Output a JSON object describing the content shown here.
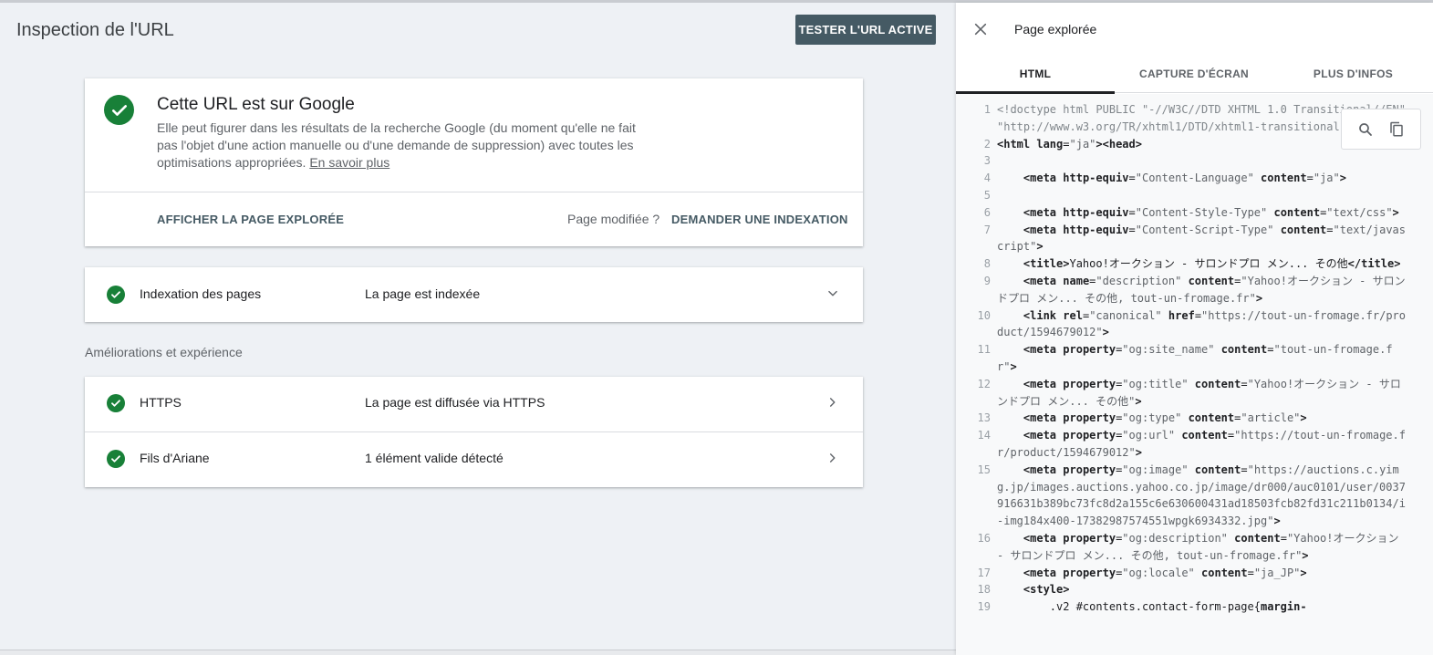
{
  "header": {
    "title": "Inspection de l'URL",
    "test_button": "TESTER L'URL ACTIVE"
  },
  "status_card": {
    "title": "Cette URL est sur Google",
    "description": "Elle peut figurer dans les résultats de la recherche Google (du moment qu'elle ne fait pas l'objet d'une action manuelle ou d'une demande de suppression) avec toutes les optimisations appropriées.",
    "learn_more": "En savoir plus",
    "view_page_button": "AFFICHER LA PAGE EXPLORÉE",
    "page_modified": "Page modifiée ?",
    "request_indexing_button": "DEMANDER UNE INDEXATION"
  },
  "indexing": {
    "label": "Indexation des pages",
    "status": "La page est indexée"
  },
  "enhancements": {
    "section_title": "Améliorations et expérience",
    "rows": [
      {
        "label": "HTTPS",
        "status": "La page est diffusée via HTTPS"
      },
      {
        "label": "Fils d'Ariane",
        "status": "1 élément valide détecté"
      }
    ]
  },
  "panel": {
    "title": "Page explorée",
    "tabs": [
      "HTML",
      "CAPTURE D'ÉCRAN",
      "PLUS D'INFOS"
    ],
    "active_tab": "HTML",
    "code_lines": [
      {
        "n": "1",
        "parts": [
          [
            "c",
            "<!doctype html PUBLIC \"-//W3C//DTD XHTML 1.0 Transitional//EN\" \"http://www.w3.org/TR/xhtml1/DTD/xhtml1-transitional.dtd\">"
          ]
        ]
      },
      {
        "n": "2",
        "parts": [
          [
            "t",
            "<html "
          ],
          [
            "a",
            "lang"
          ],
          [
            "p",
            "="
          ],
          [
            "v",
            "\"ja\""
          ],
          [
            "t",
            "><head>"
          ]
        ]
      },
      {
        "n": "3",
        "parts": []
      },
      {
        "n": "4",
        "parts": [
          [
            "p",
            "    "
          ],
          [
            "t",
            "<meta "
          ],
          [
            "a",
            "http-equiv"
          ],
          [
            "p",
            "="
          ],
          [
            "v",
            "\"Content-Language\""
          ],
          [
            "p",
            " "
          ],
          [
            "a",
            "content"
          ],
          [
            "p",
            "="
          ],
          [
            "v",
            "\"ja\""
          ],
          [
            "t",
            ">"
          ]
        ]
      },
      {
        "n": "5",
        "parts": []
      },
      {
        "n": "6",
        "parts": [
          [
            "p",
            "    "
          ],
          [
            "t",
            "<meta "
          ],
          [
            "a",
            "http-equiv"
          ],
          [
            "p",
            "="
          ],
          [
            "v",
            "\"Content-Style-Type\""
          ],
          [
            "p",
            " "
          ],
          [
            "a",
            "content"
          ],
          [
            "p",
            "="
          ],
          [
            "v",
            "\"text/css\""
          ],
          [
            "t",
            ">"
          ]
        ]
      },
      {
        "n": "7",
        "parts": [
          [
            "p",
            "    "
          ],
          [
            "t",
            "<meta "
          ],
          [
            "a",
            "http-equiv"
          ],
          [
            "p",
            "="
          ],
          [
            "v",
            "\"Content-Script-Type\""
          ],
          [
            "p",
            " "
          ],
          [
            "a",
            "content"
          ],
          [
            "p",
            "="
          ],
          [
            "v",
            "\"text/javascript\""
          ],
          [
            "t",
            ">"
          ]
        ]
      },
      {
        "n": "8",
        "parts": [
          [
            "p",
            "    "
          ],
          [
            "t",
            "<title>"
          ],
          [
            "p",
            "Yahoo!オークション - サロンドプロ メン... その他"
          ],
          [
            "t",
            "</title>"
          ]
        ]
      },
      {
        "n": "9",
        "parts": [
          [
            "p",
            "    "
          ],
          [
            "t",
            "<meta "
          ],
          [
            "a",
            "name"
          ],
          [
            "p",
            "="
          ],
          [
            "v",
            "\"description\""
          ],
          [
            "p",
            " "
          ],
          [
            "a",
            "content"
          ],
          [
            "p",
            "="
          ],
          [
            "v",
            "\"Yahoo!オークション - サロンドプロ メン... その他, tout-un-fromage.fr\""
          ],
          [
            "t",
            ">"
          ]
        ]
      },
      {
        "n": "10",
        "parts": [
          [
            "p",
            "    "
          ],
          [
            "t",
            "<link "
          ],
          [
            "a",
            "rel"
          ],
          [
            "p",
            "="
          ],
          [
            "v",
            "\"canonical\""
          ],
          [
            "p",
            " "
          ],
          [
            "a",
            "href"
          ],
          [
            "p",
            "="
          ],
          [
            "v",
            "\"https://tout-un-fromage.fr/product/1594679012\""
          ],
          [
            "t",
            ">"
          ]
        ]
      },
      {
        "n": "11",
        "parts": [
          [
            "p",
            "    "
          ],
          [
            "t",
            "<meta "
          ],
          [
            "a",
            "property"
          ],
          [
            "p",
            "="
          ],
          [
            "v",
            "\"og:site_name\""
          ],
          [
            "p",
            " "
          ],
          [
            "a",
            "content"
          ],
          [
            "p",
            "="
          ],
          [
            "v",
            "\"tout-un-fromage.fr\""
          ],
          [
            "t",
            ">"
          ]
        ]
      },
      {
        "n": "12",
        "parts": [
          [
            "p",
            "    "
          ],
          [
            "t",
            "<meta "
          ],
          [
            "a",
            "property"
          ],
          [
            "p",
            "="
          ],
          [
            "v",
            "\"og:title\""
          ],
          [
            "p",
            " "
          ],
          [
            "a",
            "content"
          ],
          [
            "p",
            "="
          ],
          [
            "v",
            "\"Yahoo!オークション - サロンドプロ メン... その他\""
          ],
          [
            "t",
            ">"
          ]
        ]
      },
      {
        "n": "13",
        "parts": [
          [
            "p",
            "    "
          ],
          [
            "t",
            "<meta "
          ],
          [
            "a",
            "property"
          ],
          [
            "p",
            "="
          ],
          [
            "v",
            "\"og:type\""
          ],
          [
            "p",
            " "
          ],
          [
            "a",
            "content"
          ],
          [
            "p",
            "="
          ],
          [
            "v",
            "\"article\""
          ],
          [
            "t",
            ">"
          ]
        ]
      },
      {
        "n": "14",
        "parts": [
          [
            "p",
            "    "
          ],
          [
            "t",
            "<meta "
          ],
          [
            "a",
            "property"
          ],
          [
            "p",
            "="
          ],
          [
            "v",
            "\"og:url\""
          ],
          [
            "p",
            " "
          ],
          [
            "a",
            "content"
          ],
          [
            "p",
            "="
          ],
          [
            "v",
            "\"https://tout-un-fromage.fr/product/1594679012\""
          ],
          [
            "t",
            ">"
          ]
        ]
      },
      {
        "n": "15",
        "parts": [
          [
            "p",
            "    "
          ],
          [
            "t",
            "<meta "
          ],
          [
            "a",
            "property"
          ],
          [
            "p",
            "="
          ],
          [
            "v",
            "\"og:image\""
          ],
          [
            "p",
            " "
          ],
          [
            "a",
            "content"
          ],
          [
            "p",
            "="
          ],
          [
            "v",
            "\"https://auctions.c.yimg.jp/images.auctions.yahoo.co.jp/image/dr000/auc0101/user/0037916631b389bc73fc8d2a155c6e630600431ad18503fcb82fd31c211b0134/i-img184x400-17382987574551wpgk6934332.jpg\""
          ],
          [
            "t",
            ">"
          ]
        ]
      },
      {
        "n": "16",
        "parts": [
          [
            "p",
            "    "
          ],
          [
            "t",
            "<meta "
          ],
          [
            "a",
            "property"
          ],
          [
            "p",
            "="
          ],
          [
            "v",
            "\"og:description\""
          ],
          [
            "p",
            " "
          ],
          [
            "a",
            "content"
          ],
          [
            "p",
            "="
          ],
          [
            "v",
            "\"Yahoo!オークション - サロンドプロ メン... その他, tout-un-fromage.fr\""
          ],
          [
            "t",
            ">"
          ]
        ]
      },
      {
        "n": "17",
        "parts": [
          [
            "p",
            "    "
          ],
          [
            "t",
            "<meta "
          ],
          [
            "a",
            "property"
          ],
          [
            "p",
            "="
          ],
          [
            "v",
            "\"og:locale\""
          ],
          [
            "p",
            " "
          ],
          [
            "a",
            "content"
          ],
          [
            "p",
            "="
          ],
          [
            "v",
            "\"ja_JP\""
          ],
          [
            "t",
            ">"
          ]
        ]
      },
      {
        "n": "18",
        "parts": [
          [
            "p",
            "    "
          ],
          [
            "t",
            "<style>"
          ]
        ]
      },
      {
        "n": "19",
        "parts": [
          [
            "p",
            "        .v2 #contents.contact-form-page{"
          ],
          [
            "t",
            "margin-"
          ]
        ]
      }
    ]
  },
  "icons": {
    "check": "check-circle-icon",
    "close": "close-icon",
    "search": "search-icon",
    "copy": "copy-icon",
    "expand": "chevron-down-icon",
    "open": "chevron-right-icon"
  },
  "colors": {
    "success_green": "#188038",
    "primary_button": "#455a64",
    "background": "#eef1f5"
  }
}
